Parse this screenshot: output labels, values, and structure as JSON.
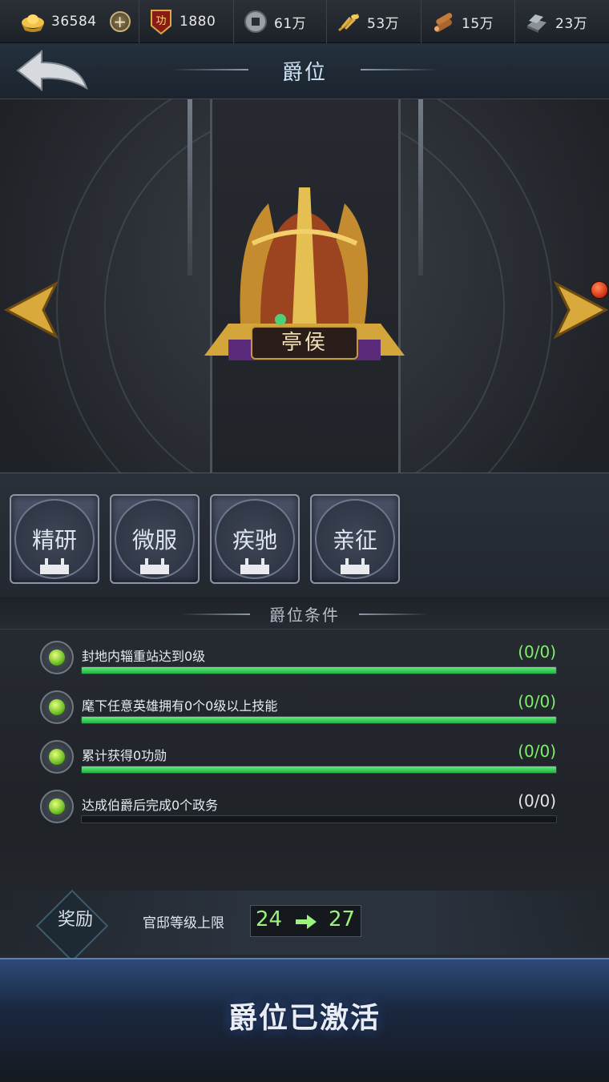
{
  "resources": [
    {
      "icon": "gold-ingot-icon",
      "value": "36584"
    },
    {
      "icon": "merit-badge-icon",
      "value": "1880"
    },
    {
      "icon": "coin-icon",
      "value": "61万"
    },
    {
      "icon": "grain-icon",
      "value": "53万"
    },
    {
      "icon": "wood-icon",
      "value": "15万"
    },
    {
      "icon": "iron-icon",
      "value": "23万"
    }
  ],
  "header": {
    "title": "爵位"
  },
  "rank": {
    "name": "亭侯"
  },
  "skills": [
    "精研",
    "微服",
    "疾驰",
    "亲征"
  ],
  "conditions_title": "爵位条件",
  "conditions": [
    {
      "text": "封地内辎重站达到0级",
      "value": "(0/0)",
      "progress": 1,
      "value_color": "#7ef06a"
    },
    {
      "text": "麾下任意英雄拥有0个0级以上技能",
      "value": "(0/0)",
      "progress": 1,
      "value_color": "#7ef06a"
    },
    {
      "text": "累计获得0功勋",
      "value": "(0/0)",
      "progress": 1,
      "value_color": "#7ef06a"
    },
    {
      "text": "达成伯爵后完成0个政务",
      "value": "(0/0)",
      "progress": 0,
      "value_color": "#e3e7ec"
    }
  ],
  "reward": {
    "label": "奖励",
    "text": "官邸等级上限",
    "from": "24",
    "to": "27"
  },
  "status_button": "爵位已激活",
  "colors": {
    "progress_green": "#2fc24f",
    "accent_gold": "#c69a3e",
    "level_green": "#9af37b"
  }
}
